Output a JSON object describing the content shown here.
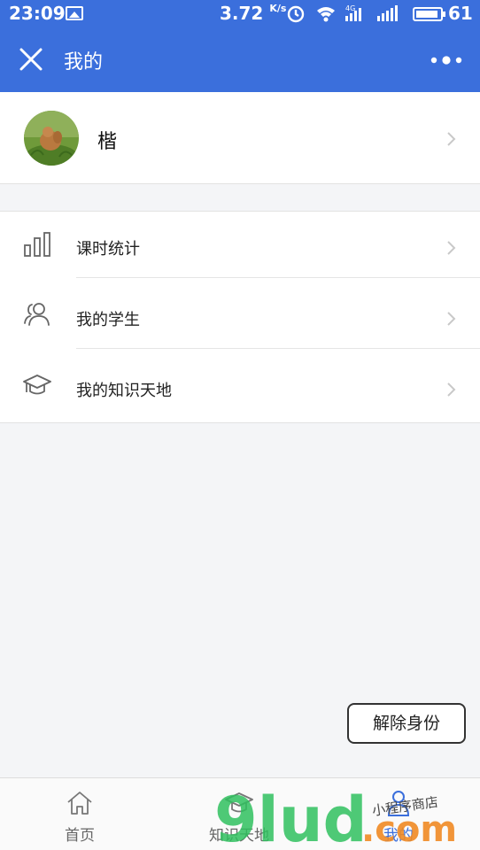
{
  "status_bar": {
    "time": "23:09",
    "net_speed": "3.72",
    "net_unit": "K/s",
    "network": "4G",
    "battery": "61"
  },
  "nav": {
    "title": "我的",
    "close_icon": "close-icon",
    "more_icon": "more-dots-icon"
  },
  "profile": {
    "name": "楷"
  },
  "menu": {
    "items": [
      {
        "label": "课时统计",
        "icon": "bar-chart-icon"
      },
      {
        "label": "我的学生",
        "icon": "users-icon"
      },
      {
        "label": "我的知识天地",
        "icon": "graduation-cap-icon"
      }
    ]
  },
  "actions": {
    "unbind_label": "解除身份"
  },
  "tabbar": {
    "tabs": [
      {
        "label": "首页",
        "icon": "home-icon"
      },
      {
        "label": "知识天地",
        "icon": "graduation-cap-icon"
      },
      {
        "label": "我的",
        "icon": "user-icon",
        "active": true
      }
    ]
  },
  "watermark": {
    "brand": "9lud",
    "suffix": ".com",
    "tagline": "小程序商店"
  },
  "colors": {
    "brand_blue": "#3b6fdc",
    "tab_active": "#3b6fdc"
  }
}
